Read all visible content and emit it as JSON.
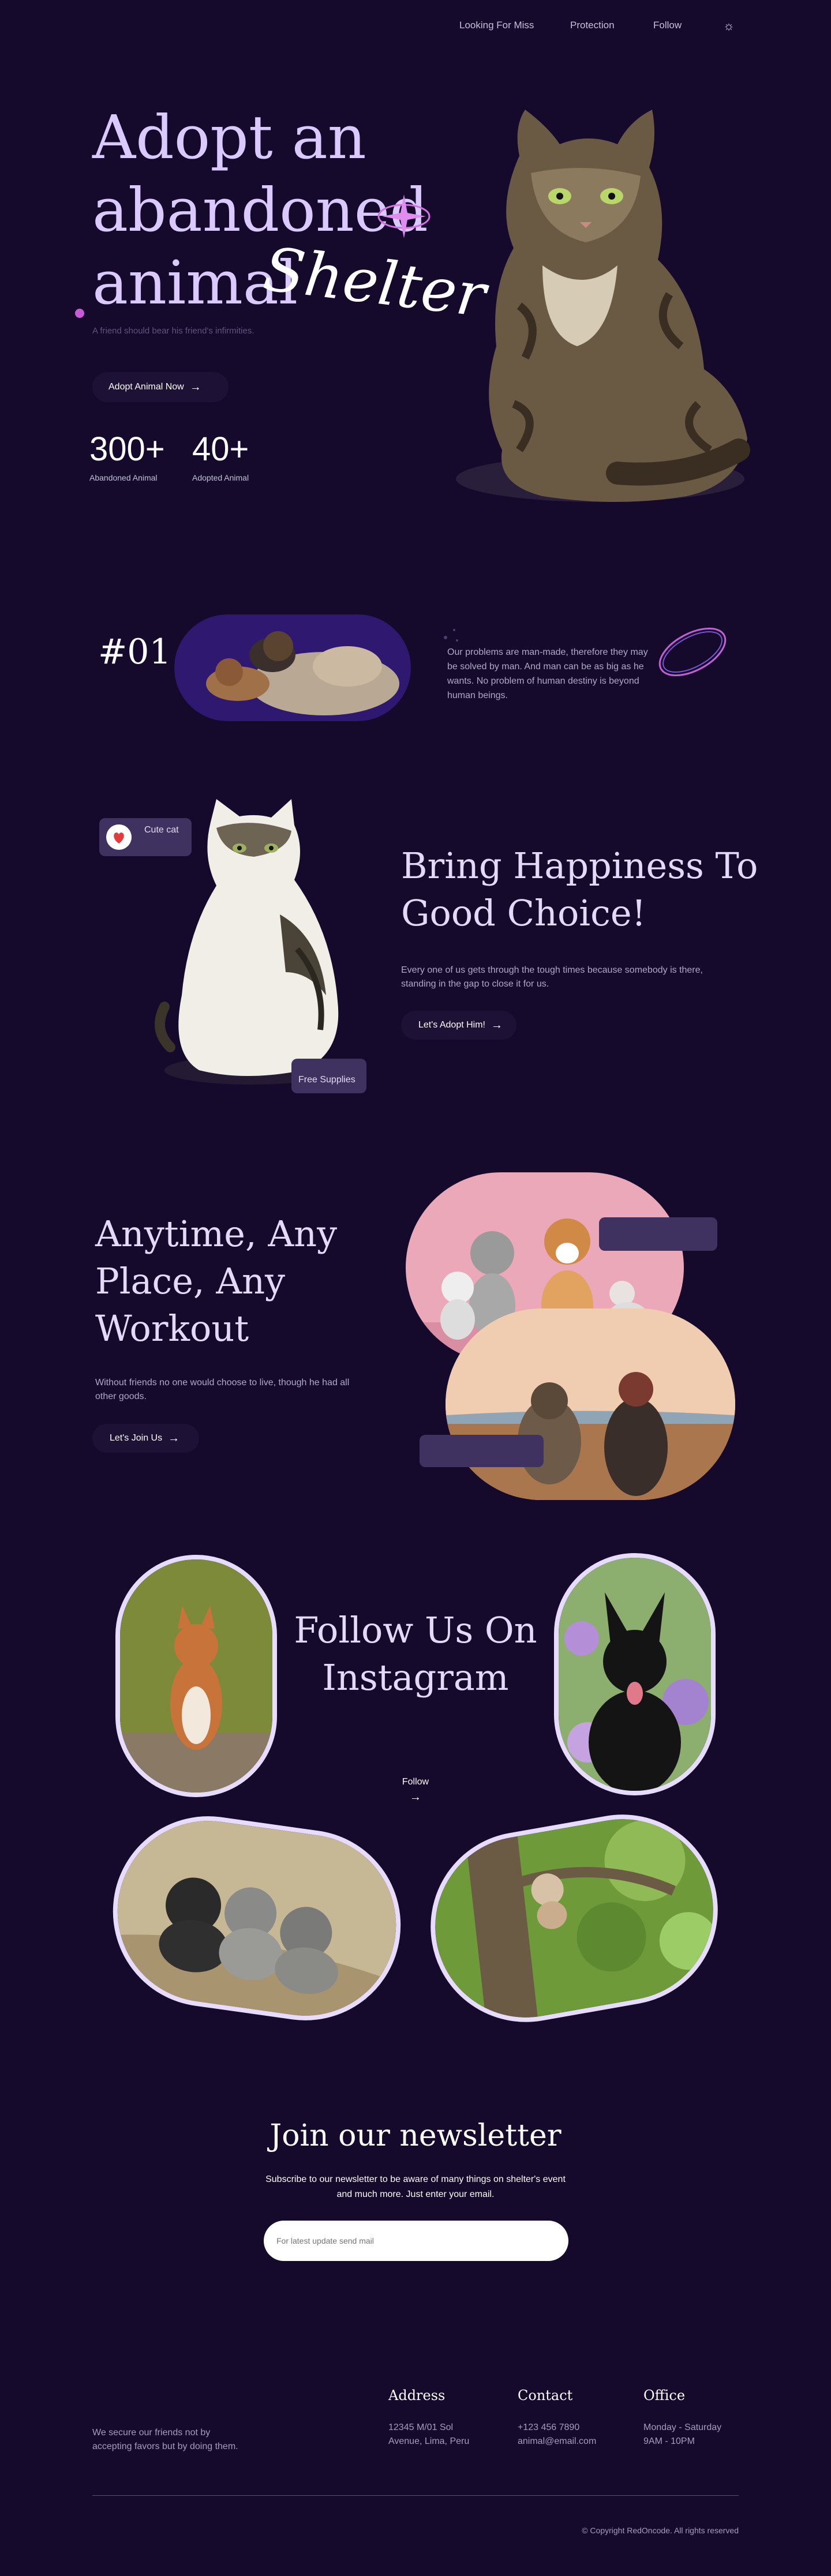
{
  "nav": {
    "items": [
      "Looking For Miss",
      "Protection",
      "Follow"
    ],
    "theme_icon": "sun-icon"
  },
  "hero": {
    "title_line1": "Adopt an",
    "title_line2": "abandoned",
    "title_line3": "animal",
    "script_word": "Shelter",
    "subtitle": "A friend should bear his friend's infirmities.",
    "cta": "Adopt Animal Now",
    "stats": [
      {
        "value": "300+",
        "label": "Abandoned Animal"
      },
      {
        "value": "40+",
        "label": "Adopted Animal"
      }
    ]
  },
  "quote": {
    "number": "#01",
    "text": "Our problems are man-made, therefore they may be solved by man. And man can be as big as he wants. No problem of human destiny is beyond human beings."
  },
  "happiness": {
    "title_line1": "Bring Happiness To",
    "title_line2": "Good Choice!",
    "text": "Every one of us gets through the tough times because somebody is there, standing in the gap to close it for us.",
    "cta": "Let's Adopt Him!",
    "badge_top": "Cute cat",
    "badge_bottom": "Free Supplies"
  },
  "workout": {
    "title_line1": "Anytime, Any",
    "title_line2": "Place, Any",
    "title_line3": "Workout",
    "text": "Without friends no one would choose to live, though he had all other goods.",
    "cta": "Let's Join Us"
  },
  "instagram": {
    "title_line1": "Follow Us On",
    "title_line2": "Instagram",
    "follow": "Follow"
  },
  "newsletter": {
    "title": "Join our newsletter",
    "text_line1": "Subscribe to our newsletter to be aware of many things on shelter's event",
    "text_line2": "and much more. Just enter your email.",
    "placeholder": "For latest update send mail"
  },
  "footer": {
    "about": "We secure our friends not by accepting favors but by doing them.",
    "columns": [
      {
        "title": "Address",
        "line1": "12345 M/01 Sol",
        "line2": "Avenue, Lima, Peru"
      },
      {
        "title": "Contact",
        "line1": "+123 456 7890",
        "line2": "animal@email.com"
      },
      {
        "title": "Office",
        "line1": "Monday - Saturday",
        "line2": "9AM - 10PM"
      }
    ],
    "copyright": "© Copyright RedOncode. All rights reserved"
  },
  "colors": {
    "background": "#150a2b",
    "accent": "#d9c9ff",
    "button_bg": "#1d1235",
    "card": "#3f3260"
  }
}
